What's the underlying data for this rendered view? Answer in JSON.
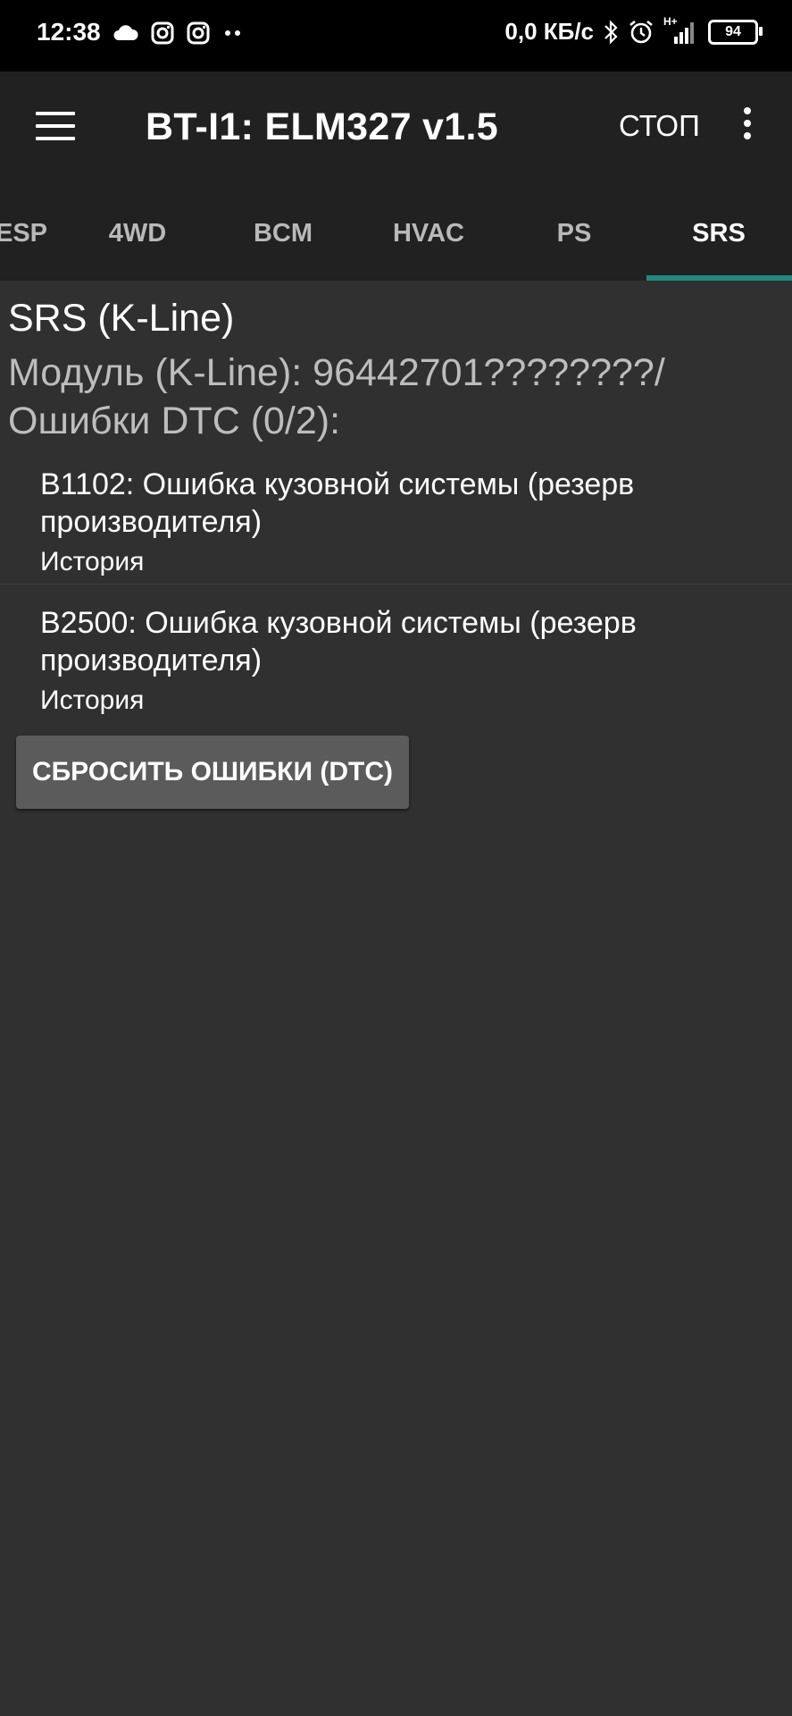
{
  "status_bar": {
    "time": "12:38",
    "left_icons": [
      "cloud-icon",
      "instagram-icon",
      "instagram-icon",
      "dots-icon"
    ],
    "speed": "0,0 КБ/с",
    "right_icons": [
      "bluetooth-icon",
      "alarm-icon",
      "signal-icon"
    ],
    "network": "H+",
    "battery": "94"
  },
  "toolbar": {
    "title": "BT-I1: ELM327 v1.5",
    "stop_label": "СТОП"
  },
  "tabs": [
    {
      "label": "ESP",
      "active": false
    },
    {
      "label": "4WD",
      "active": false
    },
    {
      "label": "BCM",
      "active": false
    },
    {
      "label": "HVAC",
      "active": false
    },
    {
      "label": "PS",
      "active": false
    },
    {
      "label": "SRS",
      "active": true
    }
  ],
  "module": {
    "title": "SRS (K-Line)",
    "id_line": "Модуль (K-Line): 96442701????????/",
    "dtc_line": "Ошибки DTC (0/2):"
  },
  "dtc": [
    {
      "text": "B1102: Ошибка кузовной системы (резерв производителя)",
      "status": "История"
    },
    {
      "text": "B2500: Ошибка кузовной системы (резерв производителя)",
      "status": "История"
    }
  ],
  "reset_button": "СБРОСИТЬ ОШИБКИ (DTC)",
  "colors": {
    "background": "#303030",
    "toolbar": "#212121",
    "accent": "#1e8b7f",
    "button": "#5b5b5b"
  }
}
